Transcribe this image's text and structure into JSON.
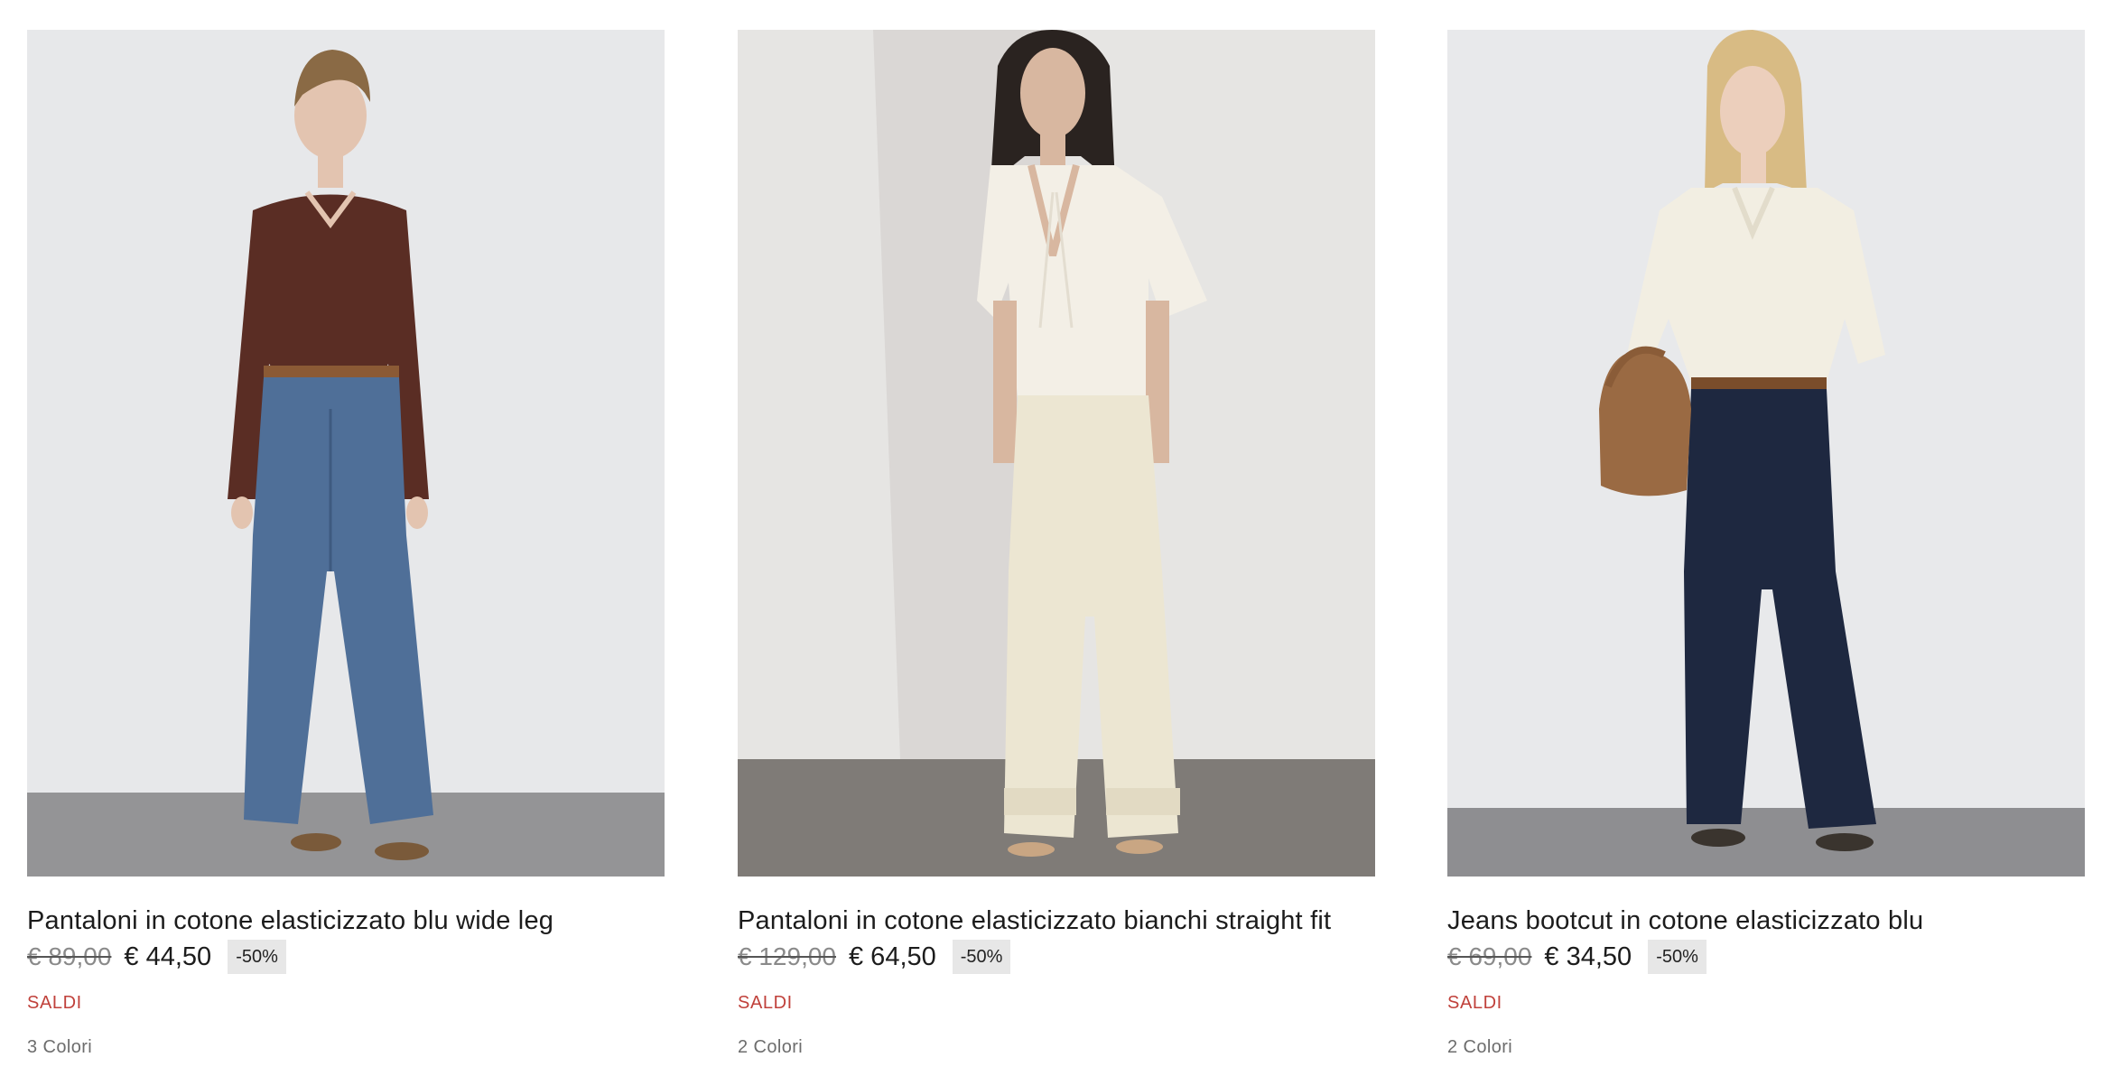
{
  "products": [
    {
      "title": "Pantaloni in cotone elasticizzato blu wide leg",
      "old_price": "€ 89,00",
      "new_price": "€ 44,50",
      "discount": "-50%",
      "sale_label": "SALDI",
      "colors": "3 Colori",
      "image": {
        "subject": "model in brown v-neck sweater and blue wide leg jeans",
        "top_color": "#5a2d24",
        "bottom_color": "#4f6f98",
        "wall_color": "#e7e8ea",
        "floor_color": "#949496"
      }
    },
    {
      "title": "Pantaloni in cotone elasticizzato bianchi straight fit",
      "old_price": "€ 129,00",
      "new_price": "€ 64,50",
      "discount": "-50%",
      "sale_label": "SALDI",
      "colors": "2 Colori",
      "image": {
        "subject": "model in ivory short sleeve blouse and ivory straight pants",
        "top_color": "#f3efe6",
        "bottom_color": "#ece6d2",
        "wall_color": "#e6e5e3",
        "floor_color": "#7f7b77"
      }
    },
    {
      "title": "Jeans bootcut in cotone elasticizzato blu",
      "old_price": "€ 69,00",
      "new_price": "€ 34,50",
      "discount": "-50%",
      "sale_label": "SALDI",
      "colors": "2 Colori",
      "image": {
        "subject": "model in cream shirt, dark blue bootcut jeans, brown suede bag",
        "top_color": "#f2eee2",
        "bottom_color": "#1e2840",
        "wall_color": "#e8e9eb",
        "floor_color": "#8e8e91"
      }
    }
  ]
}
